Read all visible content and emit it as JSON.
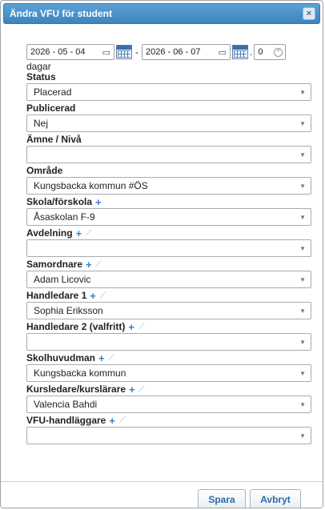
{
  "dialog": {
    "title": "Ändra VFU för student",
    "close_glyph": "×"
  },
  "dates": {
    "start": "2026 - 05 - 04",
    "end": "2026 - 06 - 07",
    "separator": "-",
    "days_value": "0",
    "days_suffix": "dagar",
    "calendar_glyph": "▭",
    "spin_glyph": "⌃"
  },
  "fields": {
    "status": {
      "label": "Status",
      "value": "Placerad"
    },
    "publicerad": {
      "label": "Publicerad",
      "value": "Nej"
    },
    "amne": {
      "label": "Ämne / Nivå",
      "value": ""
    },
    "omrade": {
      "label": "Område",
      "value": "Kungsbacka kommun #ÖS"
    },
    "skola": {
      "label": "Skola/förskola",
      "value": "Åsaskolan F-9"
    },
    "avdelning": {
      "label": "Avdelning",
      "value": ""
    },
    "samordnare": {
      "label": "Samordnare",
      "value": "Adam Licovic"
    },
    "handledare1": {
      "label": "Handledare 1",
      "value": "Sophia Eriksson"
    },
    "handledare2": {
      "label": "Handledare 2 (valfritt)",
      "value": ""
    },
    "skolhuvudman": {
      "label": "Skolhuvudman",
      "value": "Kungsbacka kommun"
    },
    "kursledare": {
      "label": "Kursledare/kurslärare",
      "value": "Valencia Bahdi"
    },
    "vfuhandlaggare": {
      "label": "VFU-handläggare",
      "value": ""
    }
  },
  "glyphs": {
    "plus": "+",
    "pencil": "⟋",
    "caret": "▼"
  },
  "buttons": {
    "save": "Spara",
    "cancel": "Avbryt"
  },
  "colors": {
    "titlebar": "#4a93cc",
    "accent": "#2f7fd0",
    "button_text": "#2d6aa6"
  }
}
